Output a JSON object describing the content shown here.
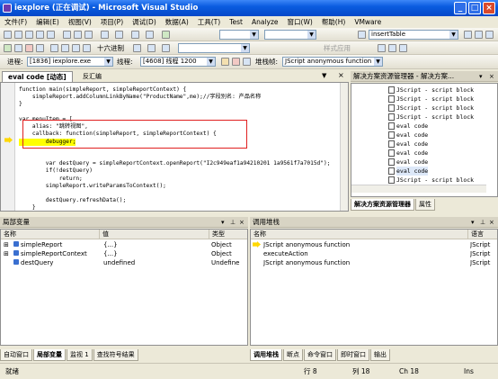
{
  "window": {
    "title": "iexplore (正在调试) - Microsoft Visual Studio",
    "min": "_",
    "max": "□",
    "close": "×"
  },
  "menu": [
    "文件(F)",
    "编辑(E)",
    "视图(V)",
    "项目(P)",
    "调试(D)",
    "数据(A)",
    "工具(T)",
    "Test",
    "Analyze",
    "窗口(W)",
    "帮助(H)",
    "VMware"
  ],
  "toolbar1": {
    "config_combo": "",
    "find_combo": "insertTable"
  },
  "toolbar2": {
    "hex_label": "十六进制",
    "apply_label": "样式应用",
    "style_combo": ""
  },
  "toolbar3": {
    "process_label": "进程:",
    "process_value": "[1836] iexplore.exe",
    "thread_label": "线程:",
    "thread_value": "[4608] 线程 1200",
    "stack_label": "堆栈帧:",
    "stack_value": "JScript anonymous function"
  },
  "editor": {
    "tab_active": "eval code [动态]",
    "tab_other": "反汇编",
    "lines": [
      "function main(simpleReport, simpleReportContext) {",
      "    simpleReport.addColumnLinkByName(\"ProductName\",me);//字段别名: 产品名称",
      "}",
      "",
      "var menuItem = [",
      "    alias: \"跳转视图\",",
      "    callback: function(simpleReport, simpleReportContext) {",
      "        debugger;",
      "",
      "",
      "        var destQuery = simpleReportContext.openReport(\"I2c949eaf1a94210201 1a9561f7a7015d\");",
      "        if(!destQuery)",
      "            return;",
      "        simpleReport.writeParamsToContext();",
      "",
      "        destQuery.refreshData();",
      "    }"
    ]
  },
  "solution": {
    "title": "解决方案资源管理器 - 解决方案...",
    "items": [
      "JScript - script block",
      "JScript - script block",
      "JScript - script block",
      "JScript - script block",
      "eval code",
      "eval code",
      "eval code",
      "eval code",
      "eval code",
      "eval code",
      "JScript - script block"
    ],
    "tab_active": "解决方案资源管理器",
    "tab_other": "属性"
  },
  "locals": {
    "title": "局部变量",
    "headers": [
      "名称",
      "值",
      "类型"
    ],
    "rows": [
      {
        "name": "simpleReport",
        "value": "{...}",
        "type": "Object"
      },
      {
        "name": "simpleReportContext",
        "value": "{...}",
        "type": "Object"
      },
      {
        "name": "destQuery",
        "value": "undefined",
        "type": "Undefine"
      }
    ],
    "tabs": [
      "自动窗口",
      "局部变量",
      "监视 1",
      "查找符号结果"
    ]
  },
  "callstack": {
    "title": "调用堆栈",
    "headers": [
      "名称",
      "语言"
    ],
    "rows": [
      {
        "name": "JScript anonymous function",
        "lang": "JScript"
      },
      {
        "name": "executeAction",
        "lang": "JScript"
      },
      {
        "name": "JScript anonymous function",
        "lang": "JScript"
      }
    ],
    "tabs": [
      "调用堆栈",
      "断点",
      "命令窗口",
      "即时窗口",
      "输出"
    ]
  },
  "status": {
    "ready": "就绪",
    "row": "行 8",
    "col": "列 18",
    "ch": "Ch 18",
    "ins": "Ins"
  },
  "colors": {
    "title_bar": "#0a5ce0",
    "highlight_box": "#e02020",
    "current_line": "#ffff00",
    "keyword": "#0000ff",
    "string": "#a31515",
    "comment": "#008000"
  }
}
